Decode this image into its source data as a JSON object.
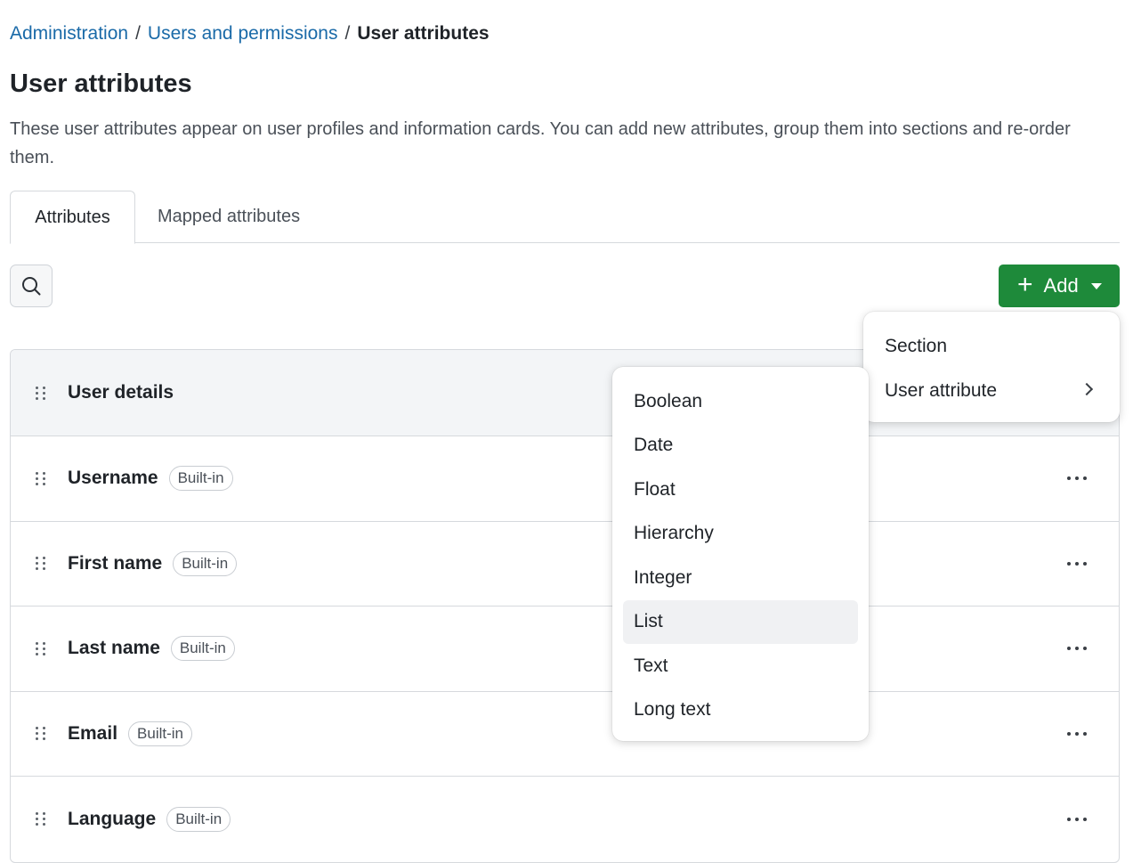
{
  "breadcrumb": {
    "items": [
      {
        "label": "Administration"
      },
      {
        "label": "Users and permissions"
      },
      {
        "label": "User attributes"
      }
    ],
    "separator": "/"
  },
  "page": {
    "title": "User attributes",
    "description": "These user attributes appear on user profiles and information cards. You can add new attributes, group them into sections and re-order them."
  },
  "tabs": [
    {
      "label": "Attributes",
      "active": true
    },
    {
      "label": "Mapped attributes",
      "active": false
    }
  ],
  "toolbar": {
    "search_icon": "search-icon",
    "add_label": "Add",
    "add_color": "#1e8a3a"
  },
  "section": {
    "title": "User details"
  },
  "rows": [
    {
      "name": "Username",
      "badge": "Built-in"
    },
    {
      "name": "First name",
      "badge": "Built-in"
    },
    {
      "name": "Last name",
      "badge": "Built-in"
    },
    {
      "name": "Email",
      "badge": "Built-in"
    },
    {
      "name": "Language",
      "badge": "Built-in"
    }
  ],
  "add_menu": {
    "items": [
      {
        "label": "Section"
      },
      {
        "label": "User attribute"
      }
    ]
  },
  "attribute_menu": {
    "items": [
      {
        "label": "Boolean"
      },
      {
        "label": "Date"
      },
      {
        "label": "Float"
      },
      {
        "label": "Hierarchy"
      },
      {
        "label": "Integer"
      },
      {
        "label": "List"
      },
      {
        "label": "Text"
      },
      {
        "label": "Long text"
      }
    ],
    "highlighted": "List"
  }
}
